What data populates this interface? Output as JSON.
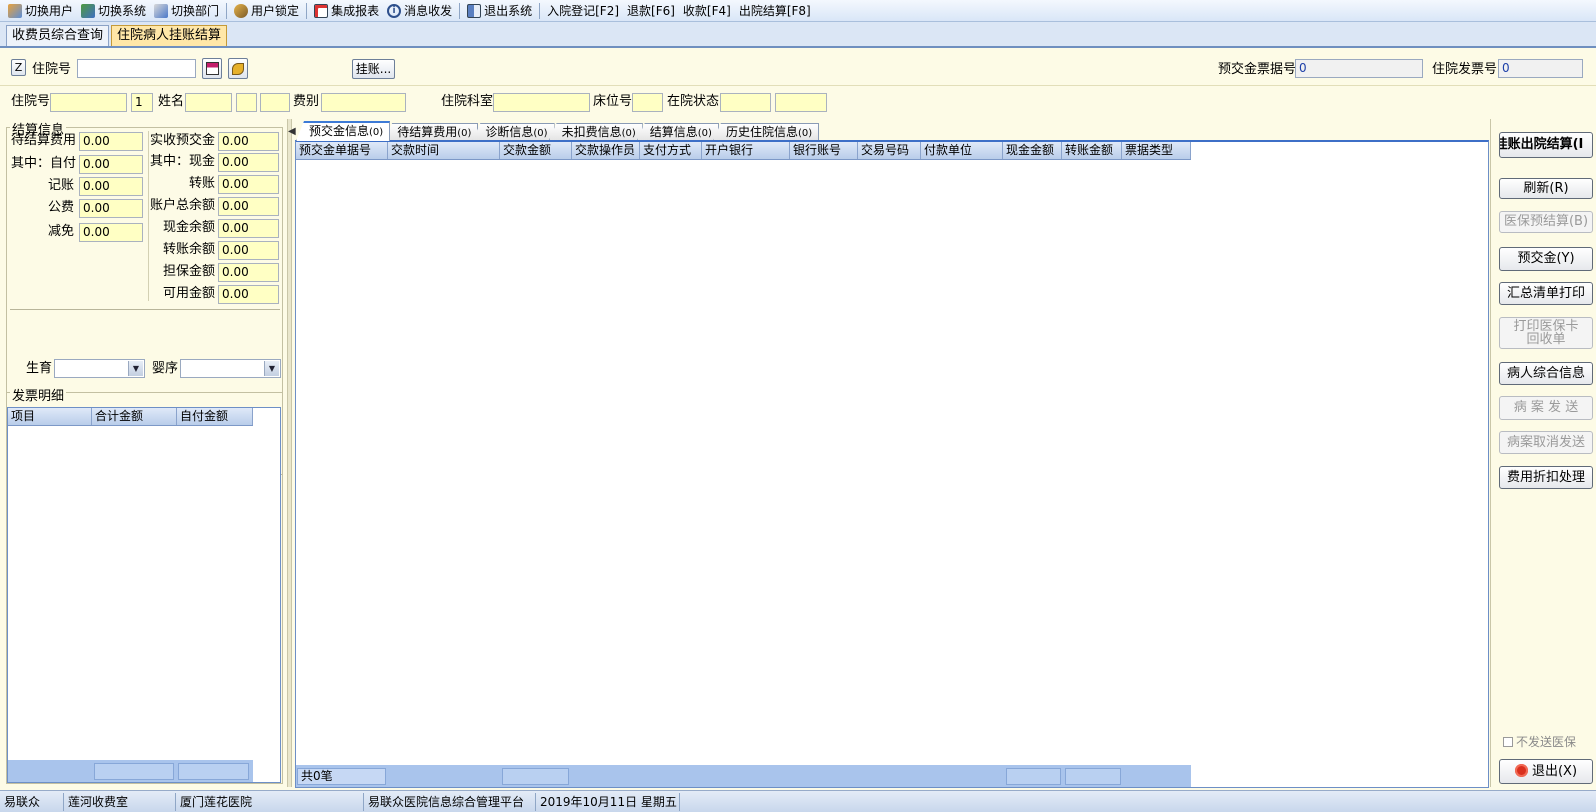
{
  "toolbar": {
    "switch_user": "切换用户",
    "switch_system": "切换系统",
    "switch_dept": "切换部门",
    "user_lock": "用户锁定",
    "integrated_report": "集成报表",
    "message": "消息收发",
    "exit_system": "退出系统",
    "admission": "入院登记[F2]",
    "refund": "退款[F6]",
    "collect": "收款[F4]",
    "discharge": "出院结算[F8]"
  },
  "module_tabs": {
    "tab1": "收费员综合查询",
    "tab2": "住院病人挂账结算"
  },
  "search": {
    "z_button": "Z",
    "admission_no_label": "住院号",
    "admission_no_value": "",
    "hang_button": "挂账...",
    "prepay_invoice_label": "预交金票据号",
    "prepay_invoice_value": "0",
    "invoice_label": "住院发票号",
    "invoice_value": "0"
  },
  "patient": {
    "admission_no_label": "住院号",
    "admission_no": "",
    "visit_count": "1",
    "name_label": "姓名",
    "name": "",
    "fee_type_label": "费别",
    "fee_type": "",
    "dept_label": "住院科室",
    "dept": "",
    "bed_label": "床位号",
    "bed": "",
    "status_label": "在院状态",
    "status": ""
  },
  "settlement": {
    "legend": "结算信息",
    "pending_label": "待结算费用",
    "pending": "0.00",
    "self_pay_label": "其中：自付",
    "self_pay": "0.00",
    "account_label": "记账",
    "account": "0.00",
    "public_label": "公费",
    "public": "0.00",
    "relief_label": "减免",
    "relief": "0.00",
    "prepaid_label": "实收预交金",
    "prepaid": "0.00",
    "cash_label": "其中：现金",
    "cash": "0.00",
    "transfer_label": "转账",
    "transfer": "0.00",
    "acct_total_label": "账户总余额",
    "acct_total": "0.00",
    "cash_balance_label": "现金余额",
    "cash_balance": "0.00",
    "transfer_balance_label": "转账余额",
    "transfer_balance": "0.00",
    "guarantee_label": "担保金额",
    "guarantee": "0.00",
    "available_label": "可用金额",
    "available": "0.00",
    "birth_label": "生育",
    "birth_value": "",
    "infant_label": "婴序",
    "infant_value": ""
  },
  "invoice_detail": {
    "legend": "发票明细",
    "columns": [
      "项目",
      "合计金额",
      "自付金额"
    ]
  },
  "center_tabs": [
    {
      "label": "预交金信息",
      "count": "(0)"
    },
    {
      "label": "待结算费用",
      "count": "(0)"
    },
    {
      "label": "诊断信息",
      "count": "(0)"
    },
    {
      "label": "未扣费信息",
      "count": "(0)"
    },
    {
      "label": "结算信息",
      "count": "(0)"
    },
    {
      "label": "历史住院信息",
      "count": "(0)"
    }
  ],
  "main_grid": {
    "columns": [
      "预交金单据号",
      "交款时间",
      "交款金额",
      "交款操作员",
      "支付方式",
      "开户银行",
      "银行账号",
      "交易号码",
      "付款单位",
      "现金金额",
      "转账金额",
      "票据类型"
    ],
    "footer_count": "共0笔"
  },
  "right_buttons": {
    "hang_discharge": "挂账出院结算(I",
    "refresh": "刷新(R)",
    "insurance_pre": "医保预结算(B)",
    "prepay": "预交金(Y)",
    "summary_print": "汇总清单打印",
    "print_card_1": "打印医保卡",
    "print_card_2": "回收单",
    "patient_info": "病人综合信息",
    "case_send": "病 案 发 送",
    "case_cancel": "病案取消发送",
    "fee_discount": "费用折扣处理",
    "no_send_insurance": "不发送医保",
    "exit": "退出(X)"
  },
  "status_bar": {
    "company": "易联众",
    "office": "莲河收费室",
    "hospital": "厦门莲花医院",
    "platform": "易联众医院信息综合管理平台",
    "date": "2019年10月11日  星期五"
  }
}
